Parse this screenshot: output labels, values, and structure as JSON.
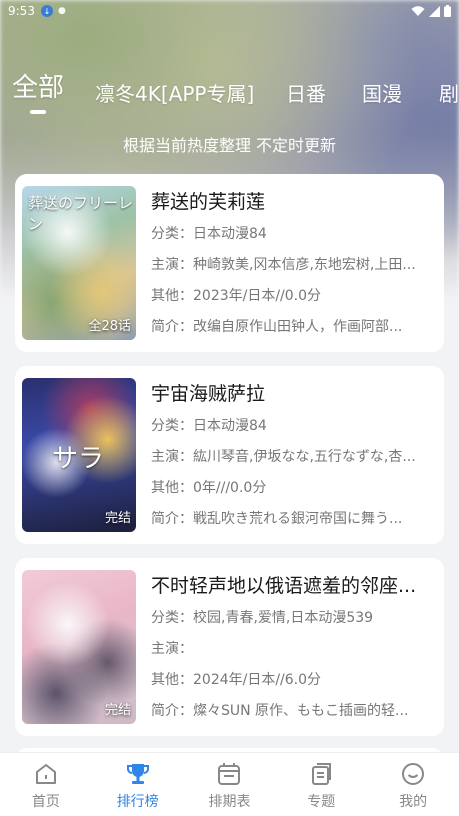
{
  "status_bar": {
    "time": "9:53",
    "icons": [
      "download-icon",
      "app-icon",
      "wifi-icon",
      "signal-icon",
      "battery-icon"
    ]
  },
  "tabs": [
    {
      "label": "全部",
      "active": true
    },
    {
      "label": "凛冬4K[APP专属]",
      "active": false
    },
    {
      "label": "日番",
      "active": false
    },
    {
      "label": "国漫",
      "active": false
    },
    {
      "label": "剧",
      "active": false
    }
  ],
  "subtitle": "根据当前热度整理 不定时更新",
  "items": [
    {
      "title": "葬送的芙莉莲",
      "category_label": "分类：",
      "category": "日本动漫84",
      "cast_label": "主演：",
      "cast": "种崎敦美,冈本信彦,东地宏树,上田...",
      "other_label": "其他：",
      "other": "2023年/日本//0.0分",
      "summary_label": "简介：",
      "summary": "改编自原作山田钟人，作画阿部...",
      "badge": "全28话",
      "cover_text": "葬送のフリーレン"
    },
    {
      "title": "宇宙海贼萨拉",
      "category_label": "分类：",
      "category": "日本动漫84",
      "cast_label": "主演：",
      "cast": "紘川琴音,伊坂なな,五行なずな,杏...",
      "other_label": "其他：",
      "other": "0年///0.0分",
      "summary_label": "简介：",
      "summary": "戦乱吹き荒れる銀河帝国に舞う...",
      "badge": "完结",
      "cover_text": "サラ"
    },
    {
      "title": "不时轻声地以俄语遮羞的邻座...",
      "category_label": "分类：",
      "category": "校园,青春,爱情,日本动漫539",
      "cast_label": "主演：",
      "cast": "",
      "other_label": "其他：",
      "other": "2024年/日本//6.0分",
      "summary_label": "简介：",
      "summary": "燦々SUN 原作、ももこ插画的轻...",
      "badge": "完结",
      "cover_text": ""
    }
  ],
  "bottom_nav": [
    {
      "label": "首页",
      "icon": "home-icon",
      "active": false
    },
    {
      "label": "排行榜",
      "icon": "trophy-icon",
      "active": true
    },
    {
      "label": "排期表",
      "icon": "calendar-icon",
      "active": false
    },
    {
      "label": "专题",
      "icon": "topic-icon",
      "active": false
    },
    {
      "label": "我的",
      "icon": "profile-icon",
      "active": false
    }
  ],
  "colors": {
    "accent": "#2f86e8",
    "nav_inactive": "#888888",
    "card_bg": "#ffffff",
    "page_bg": "#f2f3f5"
  }
}
